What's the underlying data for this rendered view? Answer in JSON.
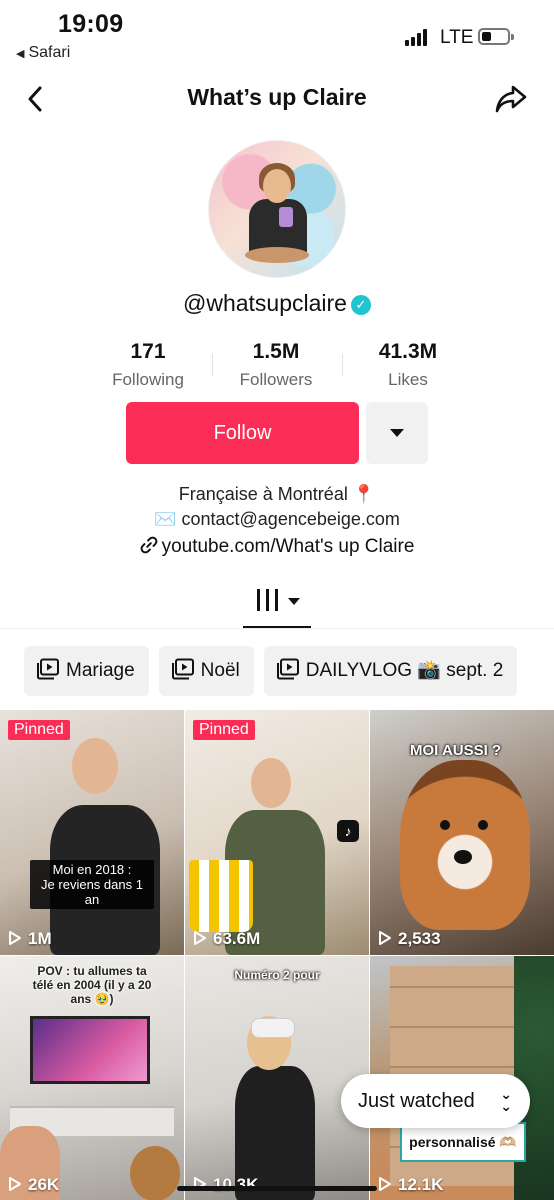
{
  "status_bar": {
    "time": "19:09",
    "back_app": "Safari",
    "network": "LTE"
  },
  "nav": {
    "title": "What’s up Claire",
    "back_icon": "chevron-left-icon",
    "share_icon": "share-arrow-icon"
  },
  "profile": {
    "handle": "@whatsupclaire",
    "verified_icon": "verified-check-icon",
    "verified_color": "#20c3d0",
    "stats": [
      {
        "value": "171",
        "label": "Following"
      },
      {
        "value": "1.5M",
        "label": "Followers"
      },
      {
        "value": "41.3M",
        "label": "Likes"
      }
    ],
    "follow_label": "Follow",
    "follow_color": "#fb2c55",
    "bio_line1": "Française à Montréal 📍",
    "bio_line2": "✉️ contact@agencebeige.com",
    "link": "youtube.com/What's up Claire"
  },
  "playlists": [
    {
      "label": "Mariage"
    },
    {
      "label": "Noël"
    },
    {
      "label": "DAILYVLOG 📸 sept. 2"
    }
  ],
  "videos": [
    {
      "views": "1M",
      "pinned": "Pinned",
      "caption": "Moi en 2018 :\nJe reviens dans 1 an"
    },
    {
      "views": "63.6M",
      "pinned": "Pinned",
      "caption": ""
    },
    {
      "views": "2,533",
      "pinned": "",
      "caption": "MOI AUSSI ?"
    },
    {
      "views": "26K",
      "pinned": "",
      "caption": "POV : tu allumes ta télé en 2004 (il y a 20 ans 🥹)"
    },
    {
      "views": "10.3K",
      "pinned": "",
      "caption": "Numéro 2 pour"
    },
    {
      "views": "12.1K",
      "pinned": "",
      "caption": "personnalisé 🫶🏼"
    }
  ],
  "just_watched": "Just watched"
}
